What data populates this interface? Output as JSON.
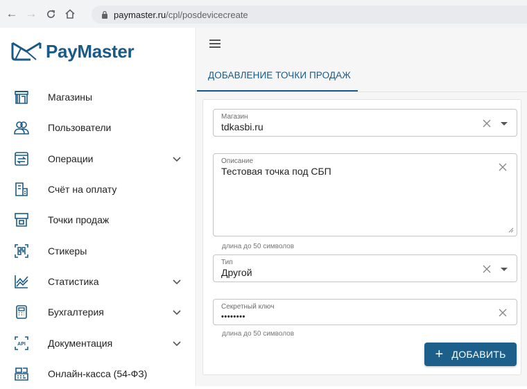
{
  "browser": {
    "back": "←",
    "forward": "→",
    "reload": "C",
    "home": "⌂",
    "url_domain": "paymaster.ru",
    "url_path": "/cpl/posdevicecreate"
  },
  "brand": {
    "name": "PayMaster",
    "color": "#1a5a86"
  },
  "sidebar": {
    "items": [
      {
        "label": "Магазины",
        "icon": "store-icon",
        "expandable": false
      },
      {
        "label": "Пользователи",
        "icon": "users-icon",
        "expandable": false
      },
      {
        "label": "Операции",
        "icon": "operations-icon",
        "expandable": true
      },
      {
        "label": "Счёт на оплату",
        "icon": "invoice-icon",
        "expandable": false
      },
      {
        "label": "Точки продаж",
        "icon": "pos-icon",
        "expandable": false
      },
      {
        "label": "Стикеры",
        "icon": "qr-sticker-icon",
        "expandable": false
      },
      {
        "label": "Статистика",
        "icon": "statistics-icon",
        "expandable": true
      },
      {
        "label": "Бухгалтерия",
        "icon": "calculator-icon",
        "expandable": true
      },
      {
        "label": "Документация",
        "icon": "api-icon",
        "expandable": true
      },
      {
        "label": "Онлайн-касса (54-ФЗ)",
        "icon": "cash-register-icon",
        "expandable": false
      }
    ]
  },
  "main": {
    "tab_label": "ДОБАВЛЕНИЕ ТОЧКИ ПРОДАЖ",
    "form": {
      "store": {
        "label": "Магазин",
        "value": "tdkasbi.ru"
      },
      "description": {
        "label": "Описание",
        "value": "Тестовая точка под СБП",
        "helper": "длина до 50 символов"
      },
      "type": {
        "label": "Тип",
        "value": "Другой"
      },
      "secret": {
        "label": "Секретный ключ",
        "value": "••••••••",
        "helper": "длина до 50 символов"
      },
      "submit_label": "ДОБАВИТЬ",
      "submit_icon": "+"
    }
  }
}
